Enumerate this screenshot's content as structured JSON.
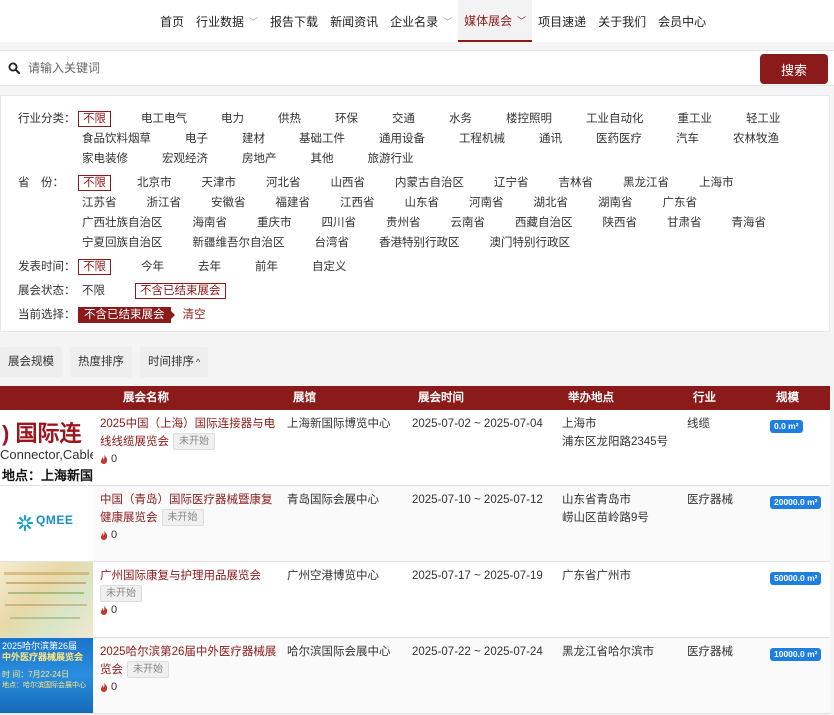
{
  "nav": {
    "items": [
      {
        "label": "首页",
        "caret": false,
        "active": false
      },
      {
        "label": "行业数据",
        "caret": true,
        "active": false
      },
      {
        "label": "报告下载",
        "caret": false,
        "active": false
      },
      {
        "label": "新闻资讯",
        "caret": false,
        "active": false
      },
      {
        "label": "企业名录",
        "caret": true,
        "active": false
      },
      {
        "label": "媒体展会",
        "caret": true,
        "active": true
      },
      {
        "label": "项目速递",
        "caret": false,
        "active": false
      },
      {
        "label": "关于我们",
        "caret": false,
        "active": false
      },
      {
        "label": "会员中心",
        "caret": false,
        "active": false
      }
    ]
  },
  "search": {
    "placeholder": "请输入关键词",
    "button": "搜索"
  },
  "filters": {
    "industry": {
      "label": "行业分类：",
      "options": [
        "不限",
        "电工电气",
        "电力",
        "供热",
        "环保",
        "交通",
        "水务",
        "楼控照明",
        "工业自动化",
        "重工业",
        "轻工业",
        "食品饮料烟草",
        "电子",
        "建材",
        "基础工件",
        "通用设备",
        "工程机械",
        "通讯",
        "医药医疗",
        "汽车",
        "农林牧渔",
        "家电装修",
        "宏观经济",
        "房地产",
        "其他",
        "旅游行业"
      ],
      "selected": 0
    },
    "province": {
      "label": "省　份：",
      "options": [
        "不限",
        "北京市",
        "天津市",
        "河北省",
        "山西省",
        "内蒙古自治区",
        "辽宁省",
        "吉林省",
        "黑龙江省",
        "上海市",
        "江苏省",
        "浙江省",
        "安徽省",
        "福建省",
        "江西省",
        "山东省",
        "河南省",
        "湖北省",
        "湖南省",
        "广东省",
        "广西壮族自治区",
        "海南省",
        "重庆市",
        "四川省",
        "贵州省",
        "云南省",
        "西藏自治区",
        "陕西省",
        "甘肃省",
        "青海省",
        "宁夏回族自治区",
        "新疆维吾尔自治区",
        "台湾省",
        "香港特别行政区",
        "澳门特别行政区"
      ],
      "selected": 0
    },
    "time": {
      "label": "发表时间：",
      "options": [
        "不限",
        "今年",
        "去年",
        "前年",
        "自定义"
      ],
      "selected": 0
    },
    "status": {
      "label": "展会状态：",
      "options": [
        "不限",
        "不含已结束展会"
      ],
      "selected": 1
    },
    "current": {
      "label": "当前选择：",
      "tag": "不含已结束展会",
      "clear": "清空"
    }
  },
  "sort": {
    "tabs": [
      {
        "label": "展会规模",
        "arrow": ""
      },
      {
        "label": "热度排序",
        "arrow": ""
      },
      {
        "label": "时间排序",
        "arrow": "^"
      }
    ]
  },
  "table": {
    "headers": {
      "name": "展会名称",
      "venue": "展馆",
      "time": "展会时间",
      "location": "举办地点",
      "industry": "行业",
      "scale": "规模"
    },
    "rows": [
      {
        "thumb_lines": [
          ") 国际连",
          "Connector,Cable",
          "地点：上海新国"
        ],
        "name": "2025中国（上海）国际连接器与电线线缆展览会",
        "status": "未开始",
        "heat": "0",
        "venue": "上海新国际博览中心",
        "time": "2025-07-02 ~ 2025-07-04",
        "location_1": "上海市",
        "location_2": "浦东区龙阳路2345号",
        "industry": "线缆",
        "scale": "0.0 m²"
      },
      {
        "thumb_lines": [
          "QMEE"
        ],
        "name": "中国（青岛）国际医疗器械暨康复健康展览会",
        "status": "未开始",
        "heat": "0",
        "venue": "青岛国际会展中心",
        "time": "2025-07-10 ~ 2025-07-12",
        "location_1": "山东省青岛市",
        "location_2": "崂山区苗岭路9号",
        "industry": "医疗器械",
        "scale": "20000.0 m²"
      },
      {
        "thumb_lines": [],
        "name": "广州国际康复与护理用品展览会",
        "status": "未开始",
        "heat": "0",
        "venue": "广州空港博览中心",
        "time": "2025-07-17 ~ 2025-07-19",
        "location_1": "广东省广州市",
        "location_2": "",
        "industry": "",
        "scale": "50000.0 m²"
      },
      {
        "thumb_lines": [
          "2025哈尔滨第26届",
          "中外医疗器械展览会",
          "时 间：7月22-24日",
          "地点：哈尔滨国际会展中心"
        ],
        "name": "2025哈尔滨第26届中外医疗器械展览会",
        "status": "未开始",
        "heat": "0",
        "venue": "哈尔滨国际会展中心",
        "time": "2025-07-22 ~ 2025-07-24",
        "location_1": "黑龙江省哈尔滨市",
        "location_2": "",
        "industry": "医疗器械",
        "scale": "10000.0 m²"
      }
    ]
  }
}
